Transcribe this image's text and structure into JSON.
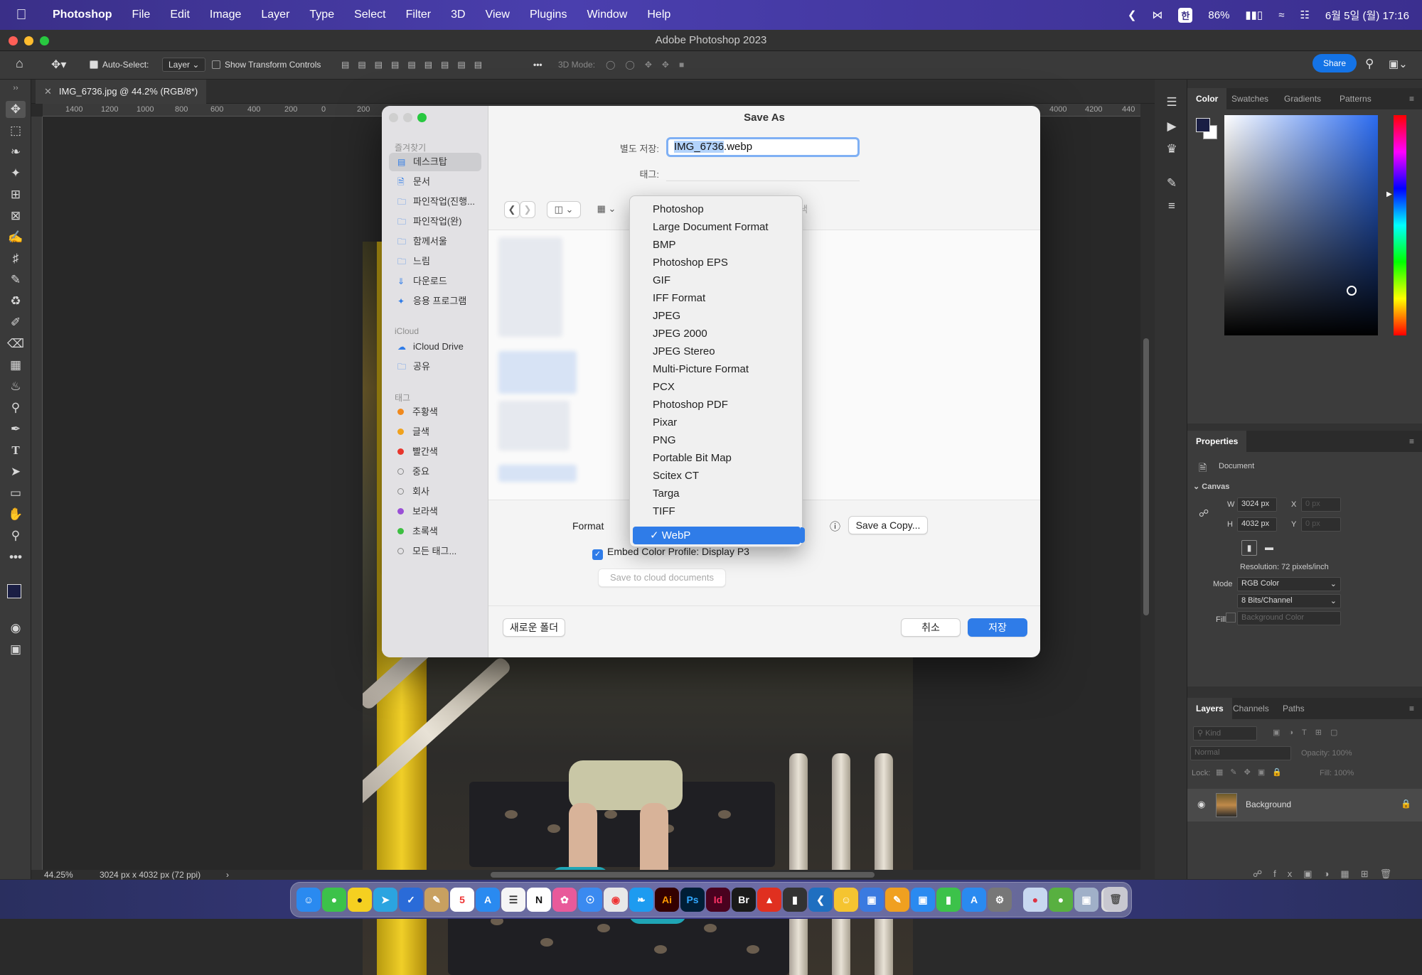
{
  "menubar": {
    "app": "Photoshop",
    "items": [
      "File",
      "Edit",
      "Image",
      "Layer",
      "Type",
      "Select",
      "Filter",
      "3D",
      "View",
      "Plugins",
      "Window",
      "Help"
    ],
    "input_badge": "한",
    "battery": "86%",
    "datetime": "6월 5일 (월) 17:16"
  },
  "window": {
    "title": "Adobe Photoshop 2023"
  },
  "options": {
    "auto_select_label": "Auto-Select:",
    "auto_select_value": "Layer",
    "show_transform": "Show Transform Controls",
    "mode_3d": "3D Mode:",
    "share": "Share"
  },
  "document": {
    "tab_title": "IMG_6736.jpg @ 44.2% (RGB/8*)",
    "ruler_ticks": [
      "1400",
      "1200",
      "1000",
      "800",
      "600",
      "400",
      "200",
      "0",
      "200",
      "4000",
      "4200",
      "440"
    ],
    "zoom": "44.25%",
    "dimensions": "3024 px x 4032 px (72 ppi)"
  },
  "dialog": {
    "title": "Save As",
    "save_as_label": "별도 저장:",
    "filename_stem": "IMG_6736",
    "filename_ext": ".webp",
    "tags_label": "태그:",
    "search_placeholder": "검색",
    "favorites_header": "즐겨찾기",
    "favorites": [
      "데스크탑",
      "문서",
      "파인작업(진행...",
      "파인작업(완)",
      "함께서울",
      "느림",
      "다운로드",
      "응용 프로그램"
    ],
    "icloud_header": "iCloud",
    "icloud": [
      "iCloud Drive",
      "공유"
    ],
    "tags_header": "태그",
    "tags": [
      {
        "label": "주황색",
        "color": "#f0891d"
      },
      {
        "label": "글색",
        "color": "#f0a21d"
      },
      {
        "label": "빨간색",
        "color": "#e8362c"
      },
      {
        "label": "중요",
        "color": "#ffffff"
      },
      {
        "label": "회사",
        "color": "#ffffff"
      },
      {
        "label": "보라색",
        "color": "#9a4fd6"
      },
      {
        "label": "초록색",
        "color": "#3dbf41"
      },
      {
        "label": "모든 태그...",
        "color": "#ffffff"
      }
    ],
    "format_label": "Format",
    "save_copy": "Save a Copy...",
    "embed_profile": "Embed Color Profile:  Display P3",
    "save_cloud": "Save to cloud documents",
    "new_folder": "새로운 폴더",
    "cancel": "취소",
    "save": "저장",
    "format_options": [
      "Photoshop",
      "Large Document Format",
      "BMP",
      "Photoshop EPS",
      "GIF",
      "IFF Format",
      "JPEG",
      "JPEG 2000",
      "JPEG Stereo",
      "Multi-Picture Format",
      "PCX",
      "Photoshop PDF",
      "Pixar",
      "PNG",
      "Portable Bit Map",
      "Scitex CT",
      "Targa",
      "TIFF"
    ],
    "format_selected": "WebP"
  },
  "panels": {
    "color_tabs": [
      "Color",
      "Swatches",
      "Gradients",
      "Patterns"
    ],
    "properties_tab": "Properties",
    "document_label": "Document",
    "canvas_header": "Canvas",
    "w_label": "W",
    "w_value": "3024 px",
    "h_label": "H",
    "h_value": "4032 px",
    "x_label": "X",
    "x_value": "0 px",
    "y_label": "Y",
    "y_value": "0 px",
    "resolution": "Resolution: 72 pixels/inch",
    "mode_label": "Mode",
    "mode_value": "RGB Color",
    "bits_value": "8 Bits/Channel",
    "fill_label": "Fill",
    "fill_value": "Background Color",
    "layers_tabs": [
      "Layers",
      "Channels",
      "Paths"
    ],
    "kind": "Kind",
    "blend": "Normal",
    "opacity": "Opacity: 100%",
    "lock": "Lock:",
    "fill": "Fill: 100%",
    "layer_name": "Background"
  },
  "colors": {
    "accent": "#2f7ce8",
    "share": "#1473e6",
    "menubar": "#3a2f88"
  }
}
